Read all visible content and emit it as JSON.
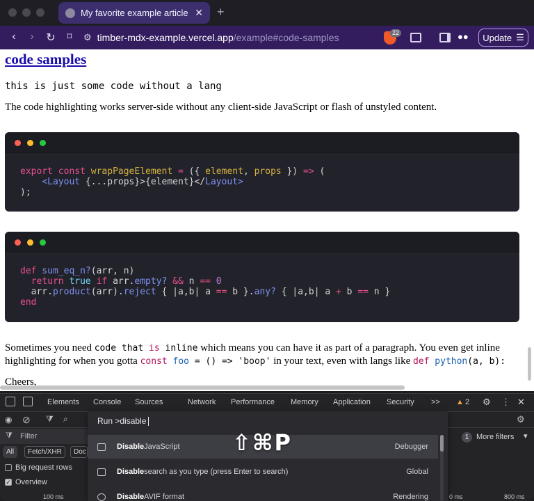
{
  "browser": {
    "tab_title": "My favorite example article | ti",
    "url_host": "timber-mdx-example.vercel.app",
    "url_path": "/example#code-samples",
    "shields_count": "22",
    "update_label": "Update"
  },
  "page": {
    "heading": "code samples",
    "plain_code": "this is just some code without a lang",
    "intro": "The code highlighting works server-side without any client-side JavaScript or flash of unstyled content.",
    "block1": {
      "l1_export": "export",
      "l1_const": "const",
      "l1_name": "wrapPageElement",
      "l1_eq": " = ",
      "l1_paren": "({ ",
      "l1_element": "element",
      "l1_comma": ", ",
      "l1_props": "props",
      "l1_close": " }) ",
      "l1_arrow": "=>",
      "l1_open": " (",
      "l2_indent": "    ",
      "l2_lt": "<",
      "l2_layout": "Layout",
      "l2_spread": " {...props}>{element}</",
      "l2_layout2": "Layout",
      "l2_gt": ">",
      "l3": ");"
    },
    "block2": {
      "l1_def": "def",
      "l1_name": " sum_eq_n?",
      "l1_args": "(arr, n)",
      "l2_return": "  return",
      "l2_true": " true",
      "l2_if": " if",
      "l2_rest": " arr.",
      "l2_empty": "empty?",
      "l2_and": " && ",
      "l2_n": "n ",
      "l2_eqeq": "==",
      "l2_zero": " 0",
      "l3_a": "  arr.",
      "l3_product": "product",
      "l3_b": "(arr).",
      "l3_reject": "reject",
      "l3_c": " { |a,b| a ",
      "l3_eq1": "==",
      "l3_d": " b }.",
      "l3_any": "any?",
      "l3_e": " { |a,b| a ",
      "l3_plus": "+",
      "l3_f": " b ",
      "l3_eq2": "==",
      "l3_g": " n }",
      "l4_end": "end"
    },
    "p2_a": "Sometimes you need ",
    "p2_code1": "code",
    "p2_code2": " that ",
    "p2_code3": "is",
    "p2_code4": " inline",
    "p2_b": " which means you can have it as part of a paragraph. You even get inline",
    "p3_a": "highlighting for when you gotta ",
    "p3_const": "const",
    "p3_foo": " foo",
    "p3_rest": " = () => ",
    "p3_str": "'boop'",
    "p3_b": " in your text, even with langs like ",
    "p3_def": "def",
    "p3_python": " python",
    "p3_args": "(a, b):",
    "cheers": "Cheers,"
  },
  "devtools": {
    "tabs": [
      "Elements",
      "Console",
      "Sources",
      "Network",
      "Performance",
      "Memory",
      "Application",
      "Security"
    ],
    "more": ">>",
    "warnings": "2",
    "filter_placeholder": "Filter",
    "type_all": "All",
    "type_fetch": "Fetch/XHR",
    "type_doc": "Doc",
    "big_rows": "Big request rows",
    "overview": "Overview",
    "more_filters_count": "1",
    "more_filters": "More filters",
    "time_100": "100 ms",
    "time_800": "800 ms",
    "time_0": "0 ms"
  },
  "command_menu": {
    "prompt": "Run  >disable",
    "items": [
      {
        "bold": "Disable",
        "rest": " JavaScript",
        "tag": "Debugger"
      },
      {
        "bold": "Disable",
        "rest": " search as you type (press Enter to search)",
        "tag": "Global"
      },
      {
        "bold": "Disable",
        "rest": " AVIF format",
        "tag": "Rendering"
      }
    ]
  },
  "hotkey": "⇧⌘P"
}
